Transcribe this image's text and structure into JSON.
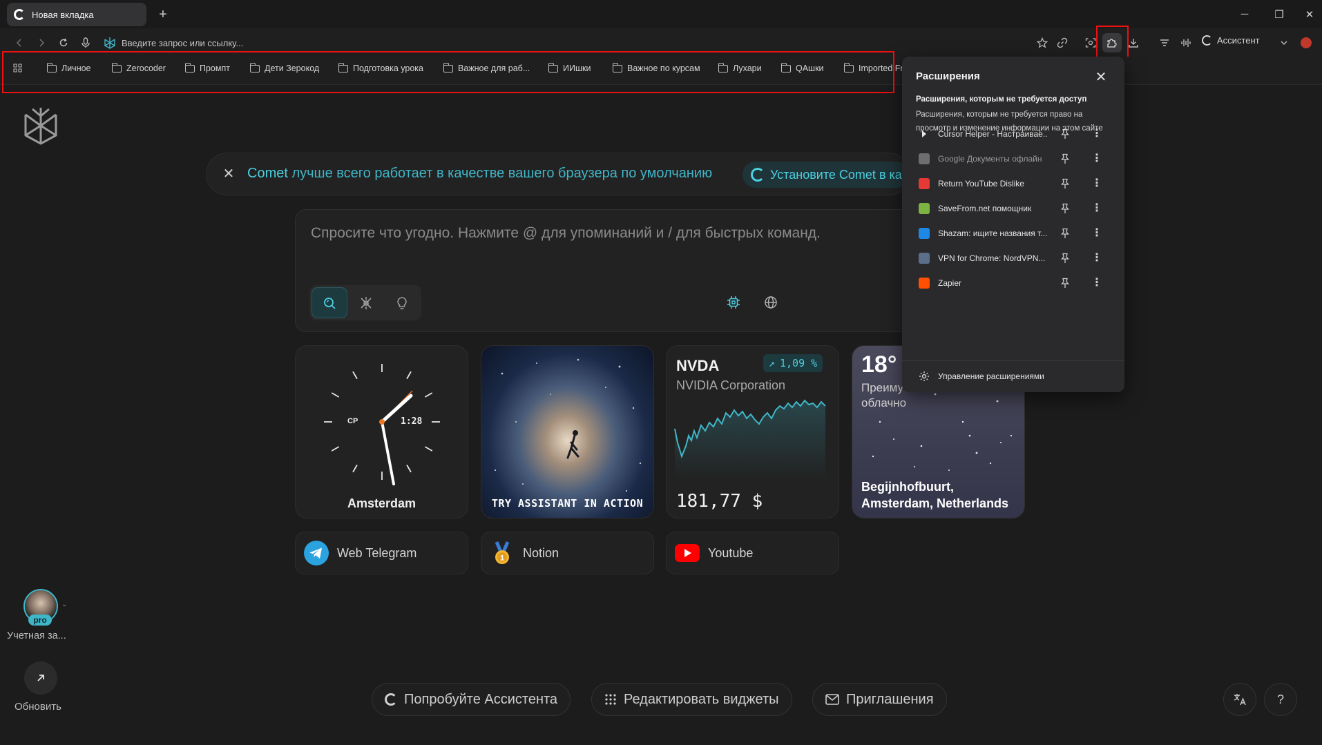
{
  "tab": {
    "title": "Новая вкладка"
  },
  "toolbar": {
    "address_placeholder": "Введите запрос или ссылку...",
    "assistant_label": "Ассистент"
  },
  "bookmarks": [
    "Личное",
    "Zerocoder",
    "Промпт",
    "Дети Зерокод",
    "Подготовка урока",
    "Важное для раб...",
    "ИИшки",
    "Важное по курсам",
    "Лухари",
    "QАшки",
    "Imported Fr"
  ],
  "banner": {
    "brand": "Comet",
    "text": "лучше всего работает в качестве вашего браузера по умолчанию",
    "cta_prefix": "Установите",
    "cta_brand": "Comet",
    "cta_suffix": "в ка"
  },
  "search": {
    "placeholder": "Спросите что угодно. Нажмите @ для упоминаний и / для быстрых команд."
  },
  "widgets": {
    "clock": {
      "day": "СР",
      "time": "1:28",
      "city": "Amsterdam"
    },
    "assistant": {
      "caption": "TRY ASSISTANT IN ACTION"
    },
    "stock": {
      "ticker": "NVDA",
      "name": "NVIDIA Corporation",
      "change": "1,09 %",
      "price": "181,77 $",
      "accent": "#3fb6c8"
    },
    "weather": {
      "temp": "18°",
      "desc": "Преиму облачно",
      "location": "Begijnhofbuurt, Amsterdam, Netherlands"
    }
  },
  "shortcuts": [
    {
      "label": "Web Telegram",
      "icon": "telegram-icon"
    },
    {
      "label": "Notion",
      "icon": "medal-icon"
    },
    {
      "label": "Youtube",
      "icon": "youtube-icon"
    }
  ],
  "sidebar": {
    "account_label": "Учетная за...",
    "pro_badge": "pro",
    "update_label": "Обновить"
  },
  "footer": {
    "try_assistant": "Попробуйте Ассистента",
    "edit_widgets": "Редактировать виджеты",
    "invites": "Приглашения"
  },
  "extensions": {
    "title": "Расширения",
    "subtitle": "Расширения, которым не требуется доступ",
    "description": "Расширения, которым не требуется право на просмотр и изменение информации на этом сайте",
    "items": [
      {
        "name": "Cursor Helper - Настраивае...",
        "color": "#1e1e1e"
      },
      {
        "name": "Google Документы офлайн",
        "color": "#6e6e6e"
      },
      {
        "name": "Return YouTube Dislike",
        "color": "#e53935"
      },
      {
        "name": "SaveFrom.net помощник",
        "color": "#7cb342"
      },
      {
        "name": "Shazam: ищите названия т...",
        "color": "#1e88e5"
      },
      {
        "name": "VPN for Chrome: NordVPN...",
        "color": "#5c6f8a"
      },
      {
        "name": "Zapier",
        "color": "#ff4f00"
      }
    ],
    "manage_label": "Управление расширениями"
  }
}
